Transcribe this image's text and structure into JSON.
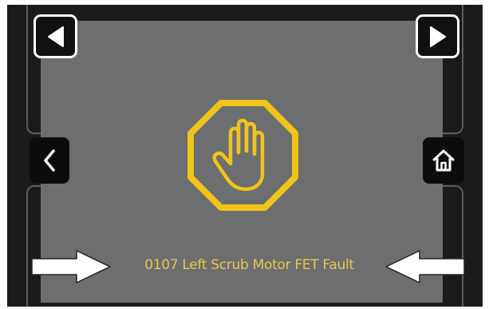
{
  "screen": {
    "fault_message": "0107 Left Scrub Motor FET Fault"
  },
  "icons": {
    "prev": "triangle-left-icon",
    "next": "triangle-right-icon",
    "back": "chevron-left-icon",
    "home": "home-icon",
    "fault": "stop-hand-icon",
    "callout_left": "arrow-right-icon",
    "callout_right": "arrow-left-icon"
  },
  "colors": {
    "screen_bg": "#6d6e6f",
    "bezel": "#1a1a1a",
    "fault": "#f0c419",
    "fault_text": "#e8c84a",
    "button_border": "#ffffff"
  }
}
